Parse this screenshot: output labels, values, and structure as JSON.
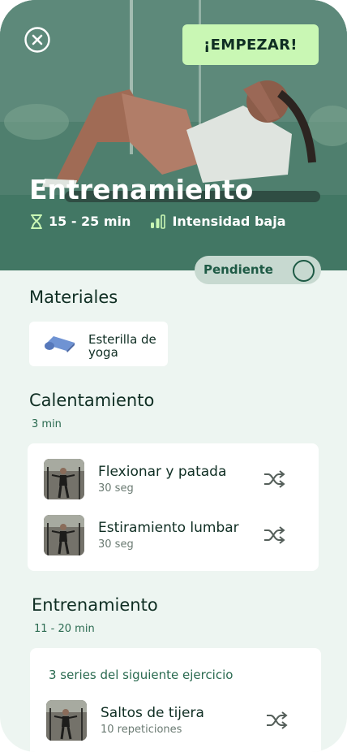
{
  "header": {
    "start_label": "¡EMPEZAR!",
    "title": "Entrenamiento",
    "duration": "15 - 25 min",
    "intensity": "Intensidad baja",
    "status": "Pendiente"
  },
  "materials": {
    "title": "Materiales",
    "items": [
      {
        "label": "Esterilla de yoga",
        "icon": "yoga-mat-icon"
      }
    ]
  },
  "warmup": {
    "title": "Calentamiento",
    "duration": "3 min",
    "exercises": [
      {
        "name": "Flexionar y patada",
        "detail": "30 seg"
      },
      {
        "name": "Estiramiento lumbar",
        "detail": "30 seg"
      }
    ]
  },
  "workout": {
    "title": "Entrenamiento",
    "duration": "11 - 20 min",
    "series_label": "3 series del siguiente ejercicio",
    "exercises": [
      {
        "name": "Saltos de tijera",
        "detail": "10 repeticiones"
      }
    ]
  },
  "colors": {
    "accent": "#c9f7b4",
    "primary_dark": "#1e5a45",
    "background": "#edf5f1"
  }
}
